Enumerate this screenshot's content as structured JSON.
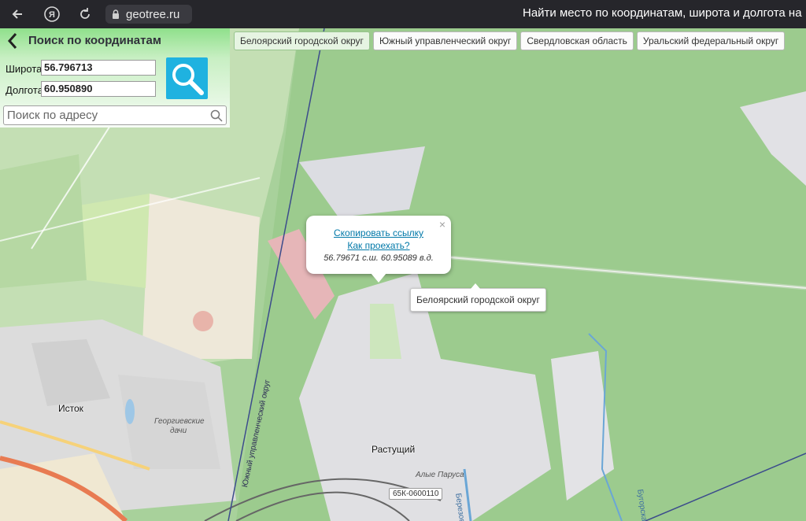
{
  "browser": {
    "url": "geotree.ru",
    "page_title": "Найти место по координатам, широта и долгота на",
    "icons": [
      "back-arrow-icon",
      "yandex-icon",
      "reload-icon",
      "lock-icon"
    ]
  },
  "search_panel": {
    "title": "Поиск по координатам",
    "lat_label": "Широта",
    "lat_value": "56.796713",
    "lon_label": "Долгота",
    "lon_value": "60.950890",
    "address_placeholder": "Поиск по адресу",
    "accent_color": "#1fb2e0"
  },
  "breadcrumbs": [
    {
      "label": "Белоярский городской округ"
    },
    {
      "label": "Южный управленческий округ"
    },
    {
      "label": "Свердловская область"
    },
    {
      "label": "Уральский федеральный округ"
    }
  ],
  "popup": {
    "copy_link": "Скопировать ссылку",
    "directions": "Как проехать?",
    "coords_text": "56.79671 с.ш. 60.95089 в.д.",
    "close": "×"
  },
  "tooltip": {
    "text": "Белоярский городской округ"
  },
  "map_labels": {
    "istok": "Исток",
    "georgievskie": "Георгиевские",
    "dachi": "дачи",
    "rastushchiy": "Растущий",
    "alye_parusa": "Алые Паруса",
    "road": "65К-0600110",
    "district_boundary": "Южный управленческий округ",
    "berezovka": "Березовка",
    "vtoraya": "Бугорская"
  }
}
